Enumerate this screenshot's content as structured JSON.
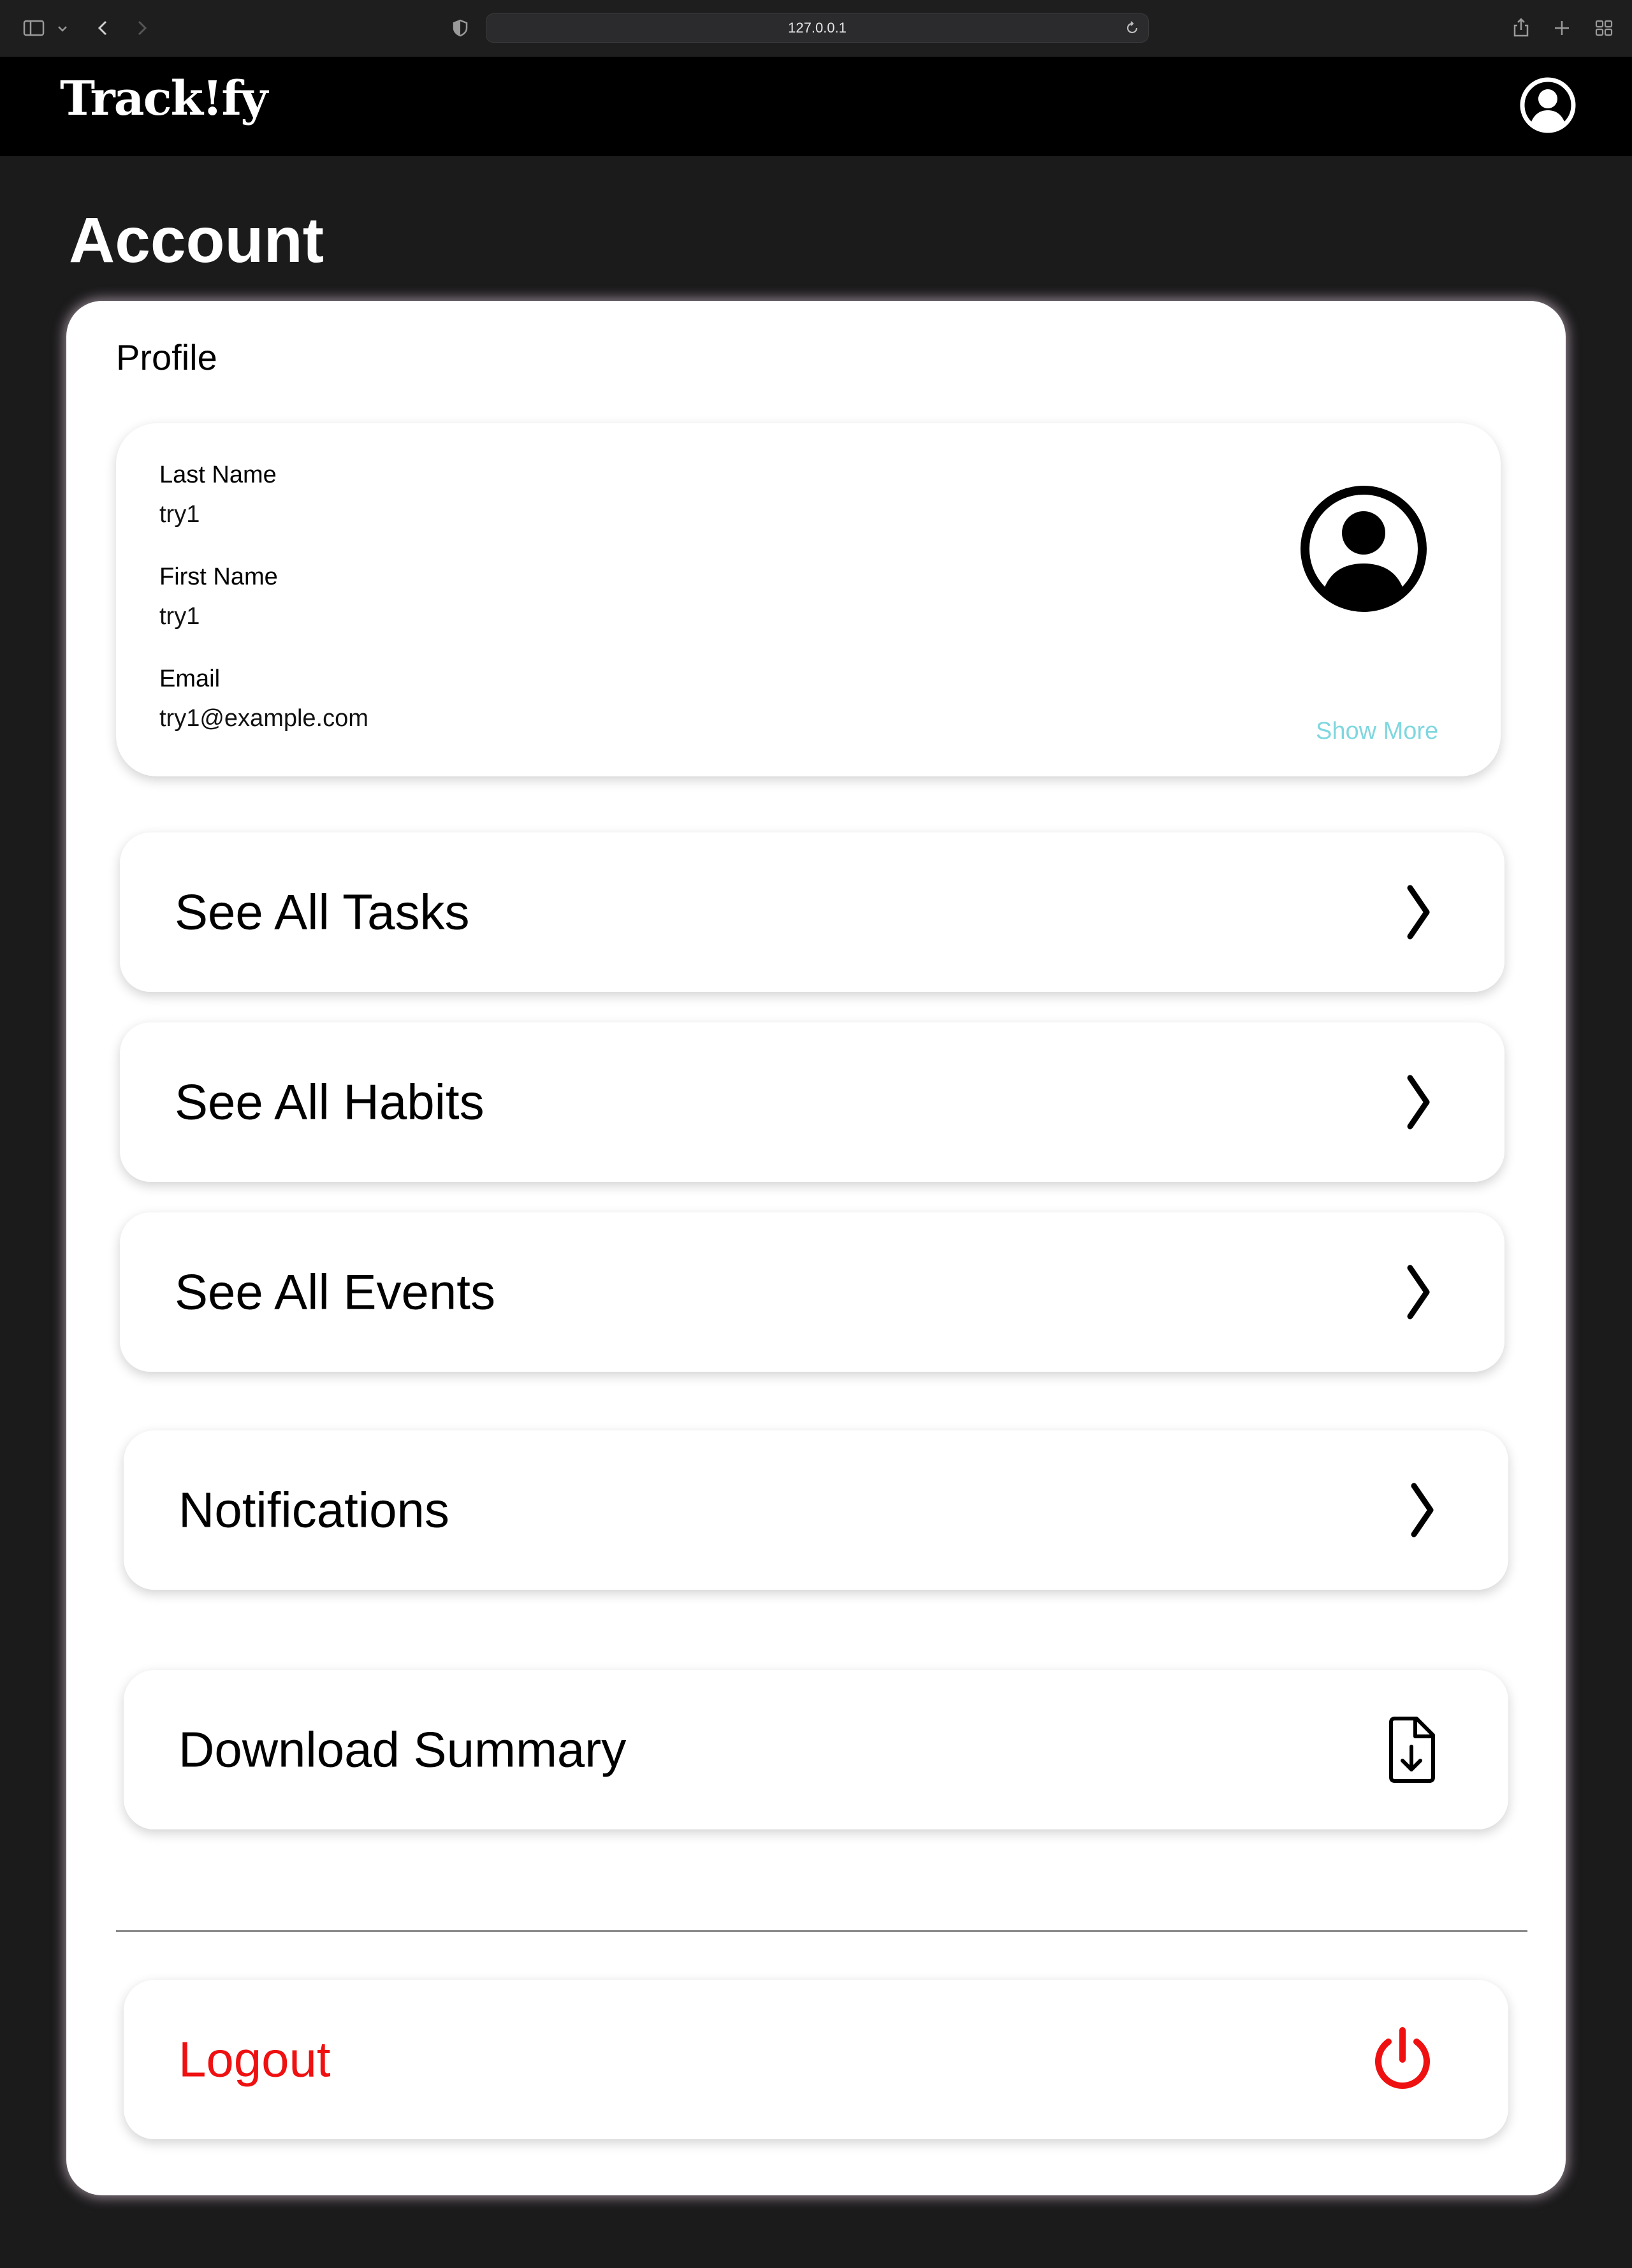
{
  "browser": {
    "url": "127.0.0.1"
  },
  "app": {
    "logo": "Track!fy",
    "brand_accent": "#8b3cf0"
  },
  "page": {
    "title": "Account"
  },
  "profile": {
    "section_title": "Profile",
    "fields": [
      {
        "label": "Last Name",
        "value": "try1"
      },
      {
        "label": "First Name",
        "value": "try1"
      },
      {
        "label": "Email",
        "value": "try1@example.com"
      }
    ],
    "show_more_label": "Show More",
    "show_more_color": "#7fd7df"
  },
  "nav": {
    "tasks": {
      "label": "See All Tasks",
      "icon": "chevron-right-icon"
    },
    "habits": {
      "label": "See All Habits",
      "icon": "chevron-right-icon"
    },
    "events": {
      "label": "See All Events",
      "icon": "chevron-right-icon"
    },
    "notifications": {
      "label": "Notifications",
      "icon": "chevron-right-icon"
    },
    "download": {
      "label": "Download Summary",
      "icon": "file-download-icon"
    },
    "logout": {
      "label": "Logout",
      "icon": "power-icon",
      "color": "#ef1111"
    }
  }
}
